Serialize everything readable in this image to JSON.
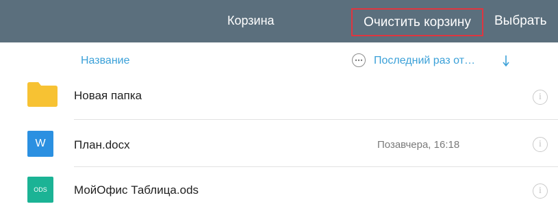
{
  "header": {
    "title": "Корзина",
    "clear_label": "Очистить корзину",
    "select_label": "Выбрать"
  },
  "sort": {
    "name_label": "Название",
    "date_label": "Последний раз от…"
  },
  "files": [
    {
      "name": "Новая папка",
      "date": "",
      "icon": "folder-icon"
    },
    {
      "name": "План.docx",
      "date": "Позавчера, 16:18",
      "icon": "word-doc-icon",
      "badge": "W"
    },
    {
      "name": "МойОфис Таблица.ods",
      "date": "",
      "icon": "ods-spreadsheet-icon",
      "badge": "ODS"
    }
  ],
  "colors": {
    "header_bg": "#5b6f7d",
    "accent": "#3aa0d8",
    "highlight_border": "#e0353f",
    "folder": "#f7c233",
    "word": "#2b90e1",
    "spreadsheet": "#1bb395"
  }
}
